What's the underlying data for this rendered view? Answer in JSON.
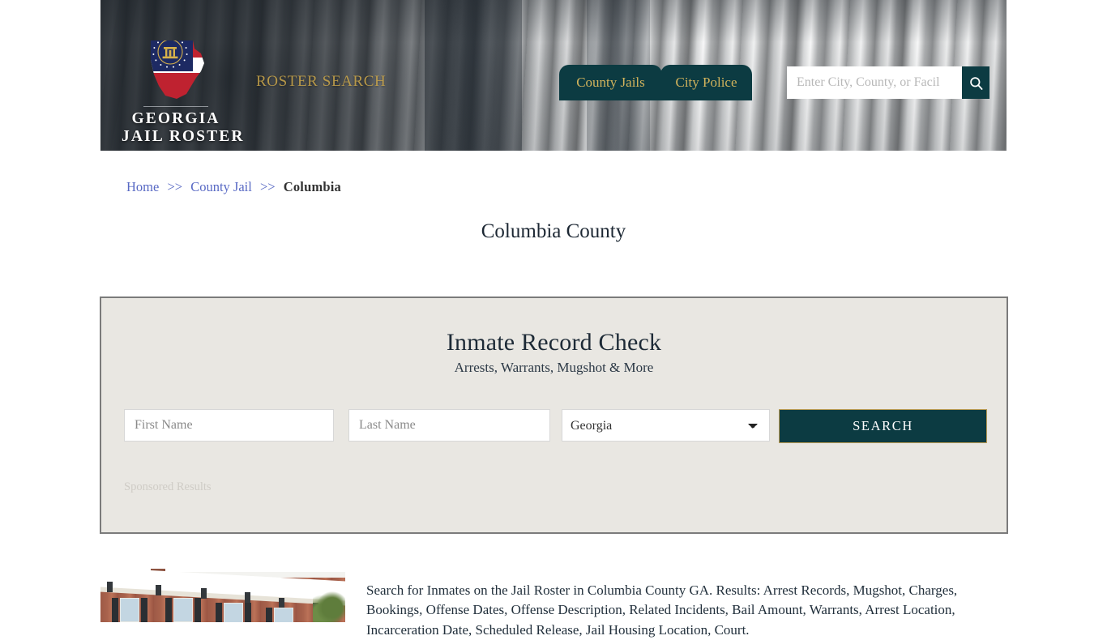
{
  "header": {
    "logo": {
      "line1": "GEORGIA",
      "line2": "JAIL ROSTER",
      "icon": "georgia-state-flag-icon"
    },
    "tagline": "ROSTER SEARCH",
    "nav": [
      {
        "label": "County Jails"
      },
      {
        "label": "City Police"
      }
    ],
    "search": {
      "placeholder": "Enter City, County, or Facil",
      "value": "",
      "icon": "search-icon"
    }
  },
  "breadcrumb": {
    "items": [
      {
        "label": "Home",
        "link": true
      },
      {
        "label": "County Jail",
        "link": true
      },
      {
        "label": "Columbia",
        "link": false
      }
    ],
    "separator": ">>"
  },
  "page": {
    "title": "Columbia County"
  },
  "panel": {
    "heading": "Inmate Record Check",
    "subheading": "Arrests, Warrants, Mugshot & More",
    "form": {
      "first_name_placeholder": "First Name",
      "first_name_value": "",
      "last_name_placeholder": "Last Name",
      "last_name_value": "",
      "state_selected": "Georgia",
      "state_options": [
        "Georgia"
      ],
      "submit_label": "SEARCH"
    },
    "sponsored_label": "Sponsored Results"
  },
  "content": {
    "thumbnail_alt": "county-courthouse-photo",
    "paragraph": "Search for Inmates on the Jail Roster in Columbia County GA. Results: Arrest Records, Mugshot, Charges, Bookings, Offense Dates, Offense Description, Related Incidents, Bail Amount, Warrants, Arrest Location, Incarceration Date, Scheduled Release, Jail Housing Location, Court."
  },
  "colors": {
    "teal": "#0c3b42",
    "gold": "#d2b35c",
    "panel_bg": "#e9e7e2",
    "link_blue": "#5869c4"
  }
}
